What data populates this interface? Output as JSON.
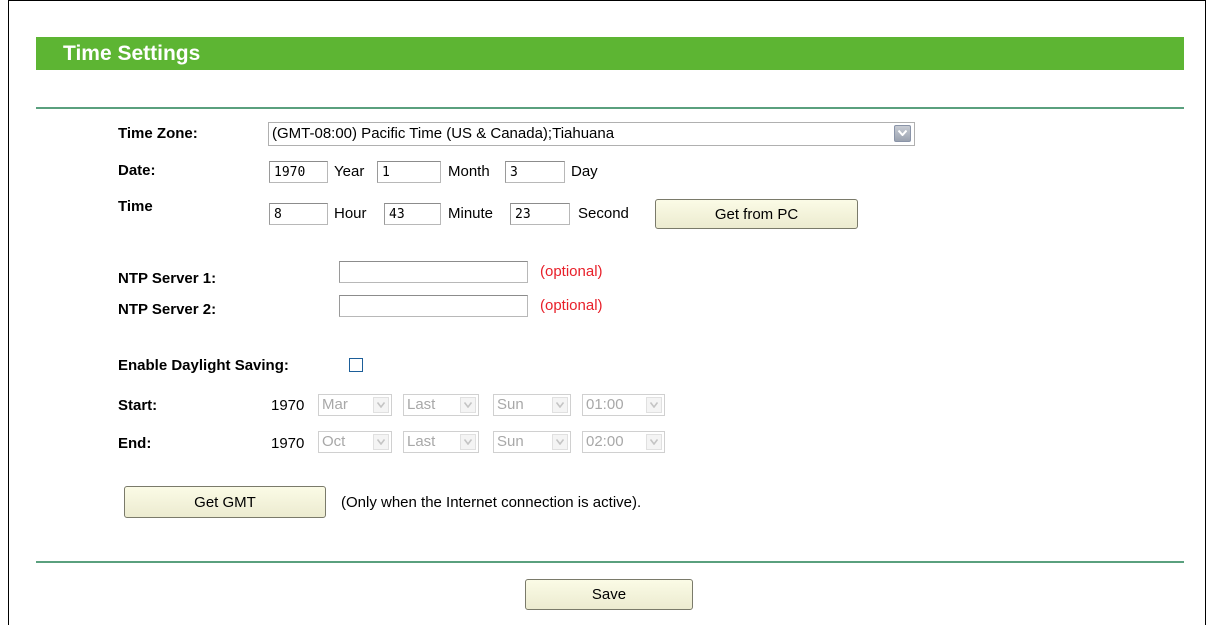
{
  "header": {
    "title": "Time Settings"
  },
  "time_zone": {
    "label": "Time Zone:",
    "selected": "(GMT-08:00) Pacific Time (US & Canada);Tiahuana"
  },
  "date": {
    "label": "Date:",
    "year_value": "1970",
    "year_unit": "Year",
    "month_value": "1",
    "month_unit": "Month",
    "day_value": "3",
    "day_unit": "Day"
  },
  "time": {
    "label": "Time",
    "hour_value": "8",
    "hour_unit": "Hour",
    "minute_value": "43",
    "minute_unit": "Minute",
    "second_value": "23",
    "second_unit": "Second",
    "get_from_pc_label": "Get from PC"
  },
  "ntp": {
    "server1_label": "NTP Server 1:",
    "server1_value": "",
    "server1_hint": "(optional)",
    "server2_label": "NTP Server 2:",
    "server2_value": "",
    "server2_hint": "(optional)"
  },
  "daylight": {
    "enable_label": "Enable Daylight Saving:",
    "enabled": false,
    "start_label": "Start:",
    "start": {
      "year": "1970",
      "month": "Mar",
      "week": "Last",
      "weekday": "Sun",
      "time": "01:00"
    },
    "end_label": "End:",
    "end": {
      "year": "1970",
      "month": "Oct",
      "week": "Last",
      "weekday": "Sun",
      "time": "02:00"
    }
  },
  "gmt": {
    "button_label": "Get GMT",
    "note": "(Only when the Internet connection is active)."
  },
  "footer": {
    "save_label": "Save"
  }
}
